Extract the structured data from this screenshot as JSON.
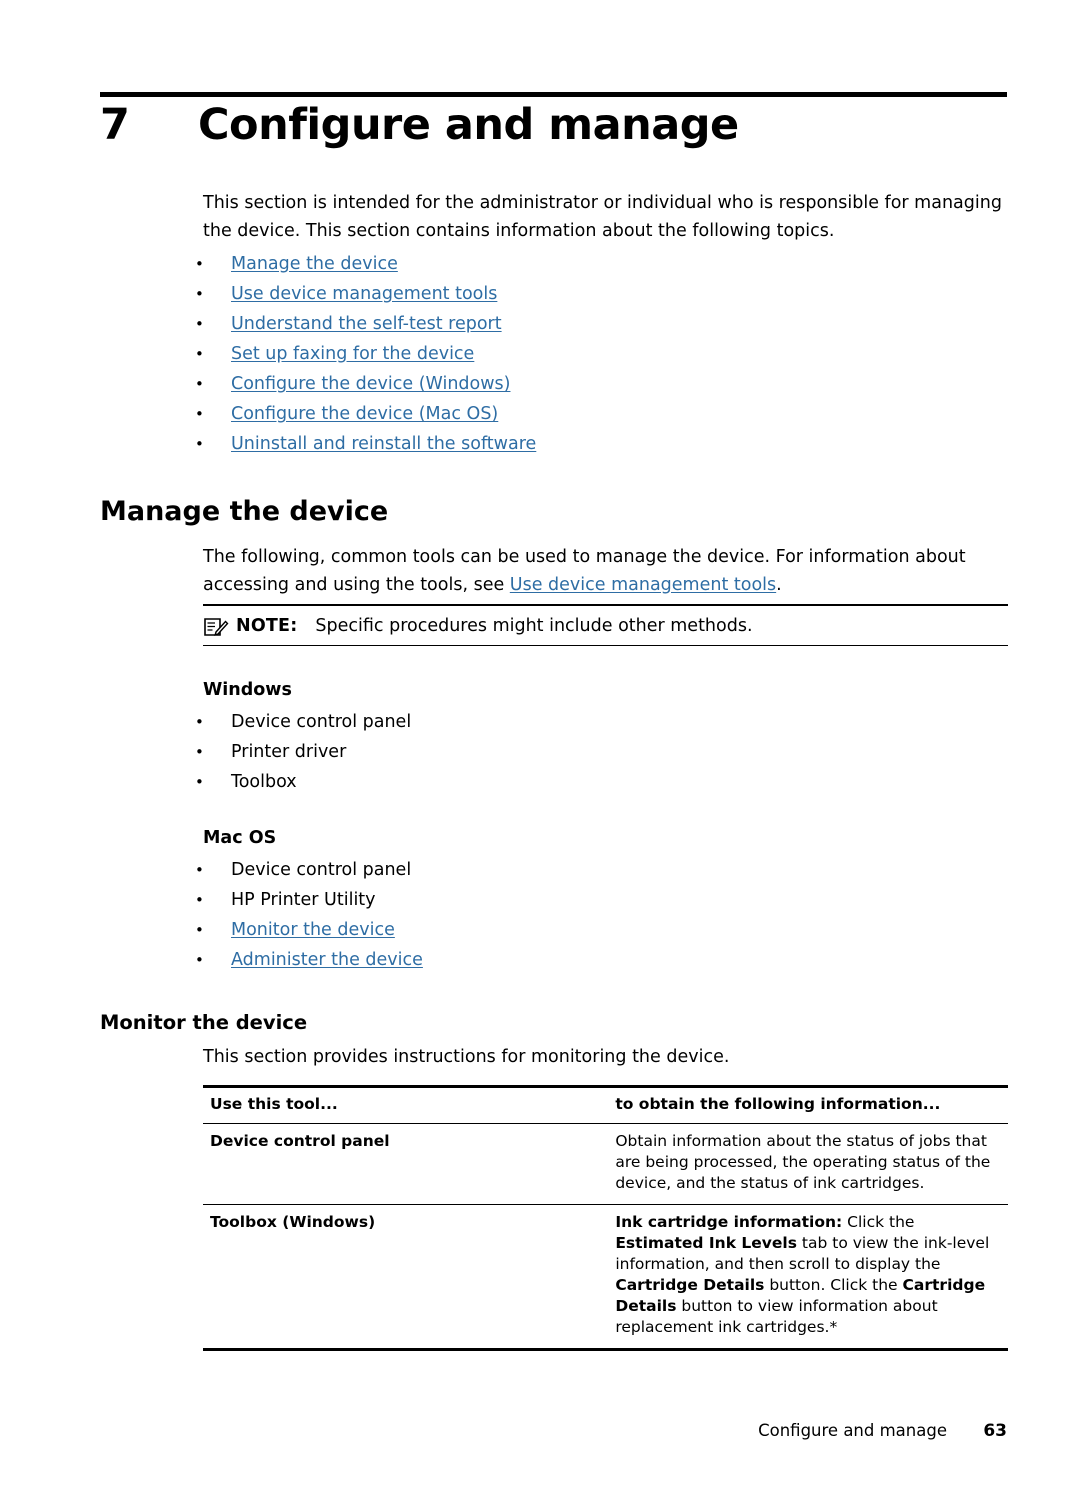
{
  "chapter": {
    "number": "7",
    "title": "Configure and manage"
  },
  "intro": "This section is intended for the administrator or individual who is responsible for managing the device. This section contains information about the following topics.",
  "toc": [
    "Manage the device",
    "Use device management tools",
    "Understand the self-test report",
    "Set up faxing for the device",
    "Configure the device (Windows)",
    "Configure the device (Mac OS)",
    "Uninstall and reinstall the software"
  ],
  "manage": {
    "heading": "Manage the device",
    "para_before_link": "The following, common tools can be used to manage the device. For information about accessing and using the tools, see ",
    "para_link": "Use device management tools",
    "para_after_link": ".",
    "note_label": "NOTE:",
    "note_text": "Specific procedures might include other methods.",
    "windows_heading": "Windows",
    "windows_items": [
      "Device control panel",
      "Printer driver",
      "Toolbox"
    ],
    "macos_heading": "Mac OS",
    "macos_items": [
      "Device control panel",
      "HP Printer Utility"
    ],
    "macos_links": [
      "Monitor the device",
      "Administer the device"
    ]
  },
  "monitor": {
    "heading": "Monitor the device",
    "para": "This section provides instructions for monitoring the device.",
    "table": {
      "headers": [
        "Use this tool...",
        "to obtain the following information..."
      ],
      "rows": [
        {
          "tool": "Device control panel",
          "info_plain": "Obtain information about the status of jobs that are being processed, the operating status of the device, and the status of ink cartridges."
        },
        {
          "tool": "Toolbox (Windows)",
          "info_rich": [
            {
              "text": "Ink cartridge information:",
              "bold": true
            },
            {
              "text": " Click the ",
              "bold": false
            },
            {
              "text": "Estimated Ink Levels",
              "bold": true
            },
            {
              "text": " tab to view the ink-level information, and then scroll to display the ",
              "bold": false
            },
            {
              "text": "Cartridge Details",
              "bold": true
            },
            {
              "text": " button. Click the ",
              "bold": false
            },
            {
              "text": "Cartridge Details",
              "bold": true
            },
            {
              "text": " button to view information about replacement ink cartridges.*",
              "bold": false
            }
          ]
        }
      ]
    }
  },
  "footer": {
    "text": "Configure and manage",
    "page": "63"
  },
  "colors": {
    "link": "#2e6da4",
    "text": "#000000",
    "rule": "#000000"
  },
  "icons": {
    "note": "note-pencil-icon",
    "bullet": "bullet-icon"
  }
}
